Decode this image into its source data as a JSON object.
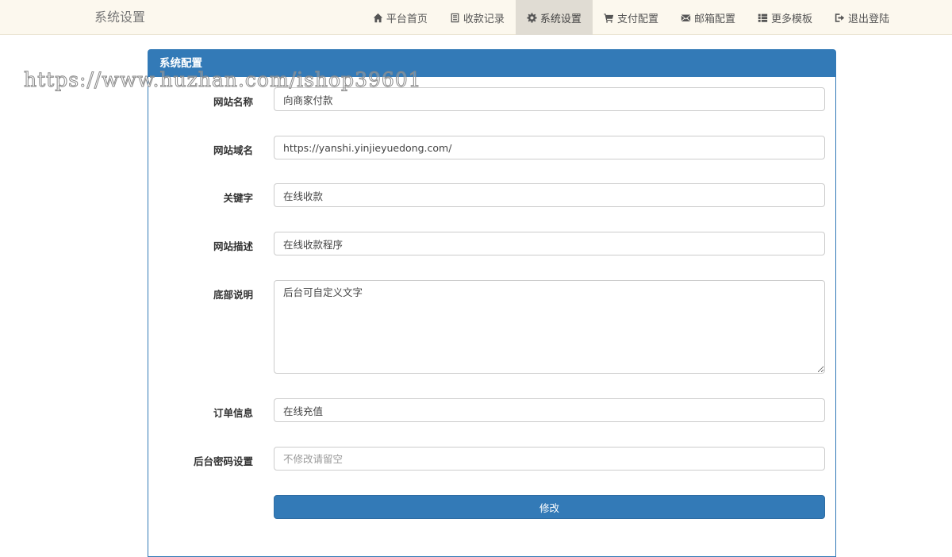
{
  "navbar": {
    "brand": "系统设置",
    "items": [
      {
        "label": "平台首页",
        "icon": "home-icon",
        "active": false
      },
      {
        "label": "收款记录",
        "icon": "list-alt-icon",
        "active": false
      },
      {
        "label": "系统设置",
        "icon": "gear-icon",
        "active": true
      },
      {
        "label": "支付配置",
        "icon": "shopping-cart-icon",
        "active": false
      },
      {
        "label": "邮箱配置",
        "icon": "envelope-icon",
        "active": false
      },
      {
        "label": "更多模板",
        "icon": "th-list-icon",
        "active": false
      },
      {
        "label": "退出登陆",
        "icon": "log-out-icon",
        "active": false
      }
    ]
  },
  "watermark": "https://www.huzhan.com/ishop39601",
  "panel": {
    "title": "系统配置",
    "fields": {
      "site_name": {
        "label": "网站名称",
        "value": "向商家付款"
      },
      "site_domain": {
        "label": "网站域名",
        "value": "https://yanshi.yinjieyuedong.com/"
      },
      "keywords": {
        "label": "关键字",
        "value": "在线收款"
      },
      "description": {
        "label": "网站描述",
        "value": "在线收款程序"
      },
      "footer": {
        "label": "底部说明",
        "value": "后台可自定义文字"
      },
      "order_info": {
        "label": "订单信息",
        "value": "在线充值"
      },
      "admin_password": {
        "label": "后台密码设置",
        "value": "",
        "placeholder": "不修改请留空"
      }
    },
    "submit_label": "修改"
  },
  "colors": {
    "primary": "#337ab7",
    "navbar_bg": "#fcf8ee",
    "nav_active_bg": "#e0dcd3"
  }
}
